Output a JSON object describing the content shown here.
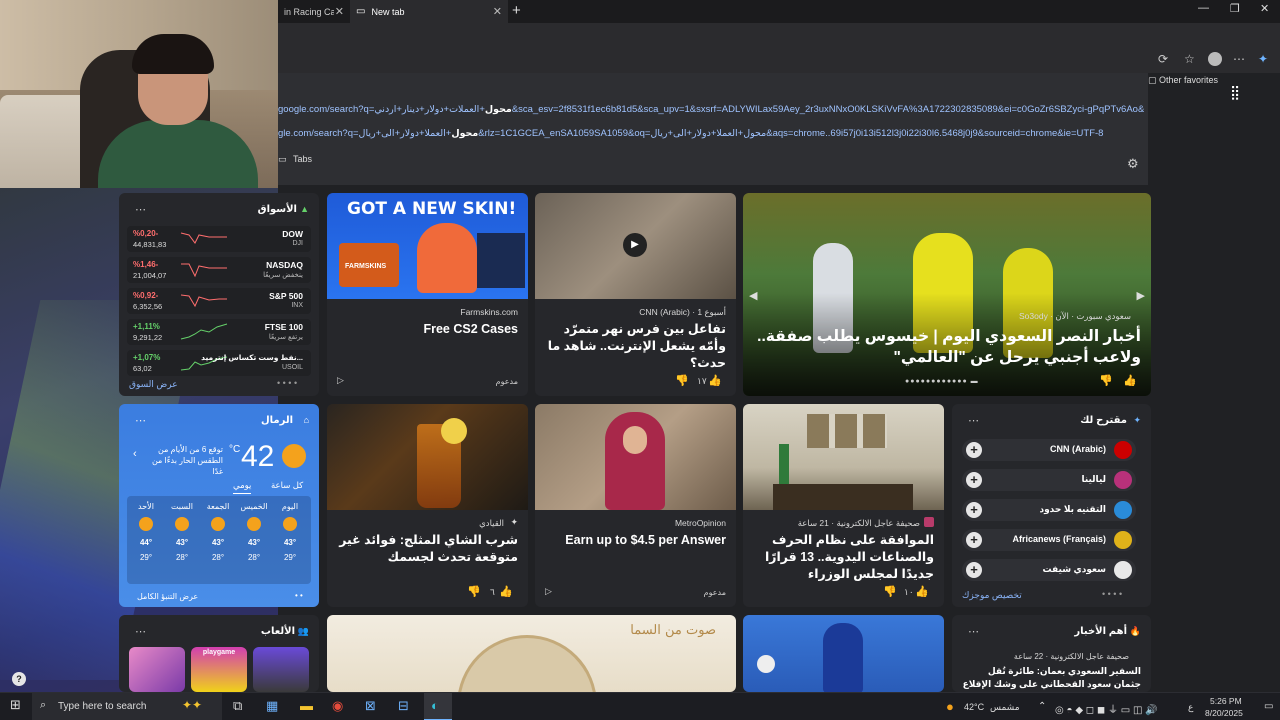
{
  "browser": {
    "tabs": [
      {
        "label": "in Racing Car |",
        "active": false
      },
      {
        "label": "New tab",
        "active": true
      }
    ],
    "other_favorites": "Other favorites",
    "suggestions": [
      {
        "prefix": "google.com/search?q=",
        "bold": "محول",
        "rest": "+العملات+دولار+دينار+اردني&sca_esv=2f8531f1ec6b81d5&sca_upv=1&sxsrf=ADLYWILax59Aey_2r3uxNNxO0KLSKiVvFA%3A1722302835089&ei=c0GoZr6SBZyci-gPqPTv6Ao&ved=0a..."
      },
      {
        "prefix": "gle.com/search?q=",
        "bold": "محول",
        "rest": "+العملا+دولار+الى+ريال&rlz=1C1GCEA_enSA1059SA1059&oq=محول+العملا+دولار+الى+ريال&aqs=chrome..69i57j0i13i512l3j0i22i30l6.5468j0j9&sourceid=chrome&ie=UTF-8"
      }
    ],
    "tabs_row_label": "Tabs"
  },
  "markets": {
    "title": "الأسواق",
    "see_more": "عرض السوق",
    "rows": [
      {
        "change": "%0,20-",
        "points": "44,831,83",
        "name": "DOW",
        "sub": "DJI",
        "up": false
      },
      {
        "change": "%1,46-",
        "points": "21,004,07",
        "name": "NASDAQ",
        "sub": "ينخفض سريعًا",
        "up": false
      },
      {
        "change": "%0,92-",
        "points": "6,352,56",
        "name": "S&P 500",
        "sub": "INX",
        "up": false
      },
      {
        "change": "+1,11%",
        "points": "9,291,22",
        "name": "FTSE 100",
        "sub": "يرتفع سريعًا",
        "up": true
      },
      {
        "change": "+1,07%",
        "points": "63,02",
        "name": "نفط وست تكساس إنترميد...",
        "sub": "USOIL",
        "up": true
      }
    ]
  },
  "promo": {
    "headline": "GOT A NEW SKIN!",
    "brand": "FARMSKINS",
    "source": "Farmskins.com",
    "title": "Free CS2 Cases",
    "sponsored": "مدعوم"
  },
  "video_card": {
    "source": "CNN (Arabic) · 1 أسبوع",
    "title": "تفاعل بين فرس نهر متمرّد وأمّه يشعل الإنترنت.. شاهد ما حدث؟",
    "likes": "١٧"
  },
  "hero": {
    "source": "So3ody · سعودي سبورت · الآن",
    "title": "أخبار النصر السعودي اليوم | خيسوس يطلب صفقة.. ولاعب أجنبي يرحل عن \"العالمي\""
  },
  "weather": {
    "location": "الرمال",
    "temp": "42",
    "unit": "°C",
    "note": "توقع 6 من الأيام من الطقس الحار بدءًا من غدًا",
    "tab_hourly": "كل ساعة",
    "tab_daily": "يومي",
    "full_forecast": "عرض التنبؤ الكامل",
    "days": [
      {
        "name": "الأحد",
        "hi": "44°",
        "lo": "29°"
      },
      {
        "name": "السبت",
        "hi": "43°",
        "lo": "28°"
      },
      {
        "name": "الجمعة",
        "hi": "43°",
        "lo": "28°"
      },
      {
        "name": "الخميس",
        "hi": "43°",
        "lo": "28°"
      },
      {
        "name": "اليوم",
        "hi": "43°",
        "lo": "29°"
      }
    ]
  },
  "tea_card": {
    "source": "القيادي",
    "title": "شرب الشاي المثلج: فوائد غير متوقعة تحدث لجسمك",
    "likes": "٦"
  },
  "earn_card": {
    "source": "MetroOpinion",
    "title": "Earn up to $4.5 per Answer",
    "sponsored": "مدعوم"
  },
  "crafts_card": {
    "source": "صحيفة عاجل الالكترونية · 21 ساعة",
    "title": "الموافقة على نظام الحرف والصناعات اليدوية.. 13 قرارًا جديدًا لمجلس الوزراء",
    "likes": "١٠"
  },
  "suggested": {
    "title": "مقترح لك",
    "customize": "تخصيص موجزك",
    "items": [
      {
        "name": "CNN (Arabic)",
        "color": "#cc0000"
      },
      {
        "name": "ليالينا",
        "color": "#b8317a"
      },
      {
        "name": "التقنيه بلا حدود",
        "color": "#2a8bd8"
      },
      {
        "name": "Africanews (Français)",
        "color": "#e0b21a"
      },
      {
        "name": "سعودي شيفت",
        "color": "#e8e8e8"
      }
    ]
  },
  "games": {
    "title": "الألعاب",
    "tile2": "playgame"
  },
  "top_news": {
    "title": "أهم الأخبار",
    "source": "صحيفة عاجل الالكترونية · 22 ساعة",
    "title2": "السفير السعودي بعمان: طائرة تُقل جثمان سعود القحطاني على وشك الإقلاع لنقله إلى..."
  },
  "banner": {
    "text": "صوت من السما"
  },
  "taskbar": {
    "search_placeholder": "Type here to search",
    "weather": "42°C",
    "weather_label": "مشمس",
    "time": "5:26 PM",
    "date": "8/20/2025",
    "lang": "ع"
  }
}
